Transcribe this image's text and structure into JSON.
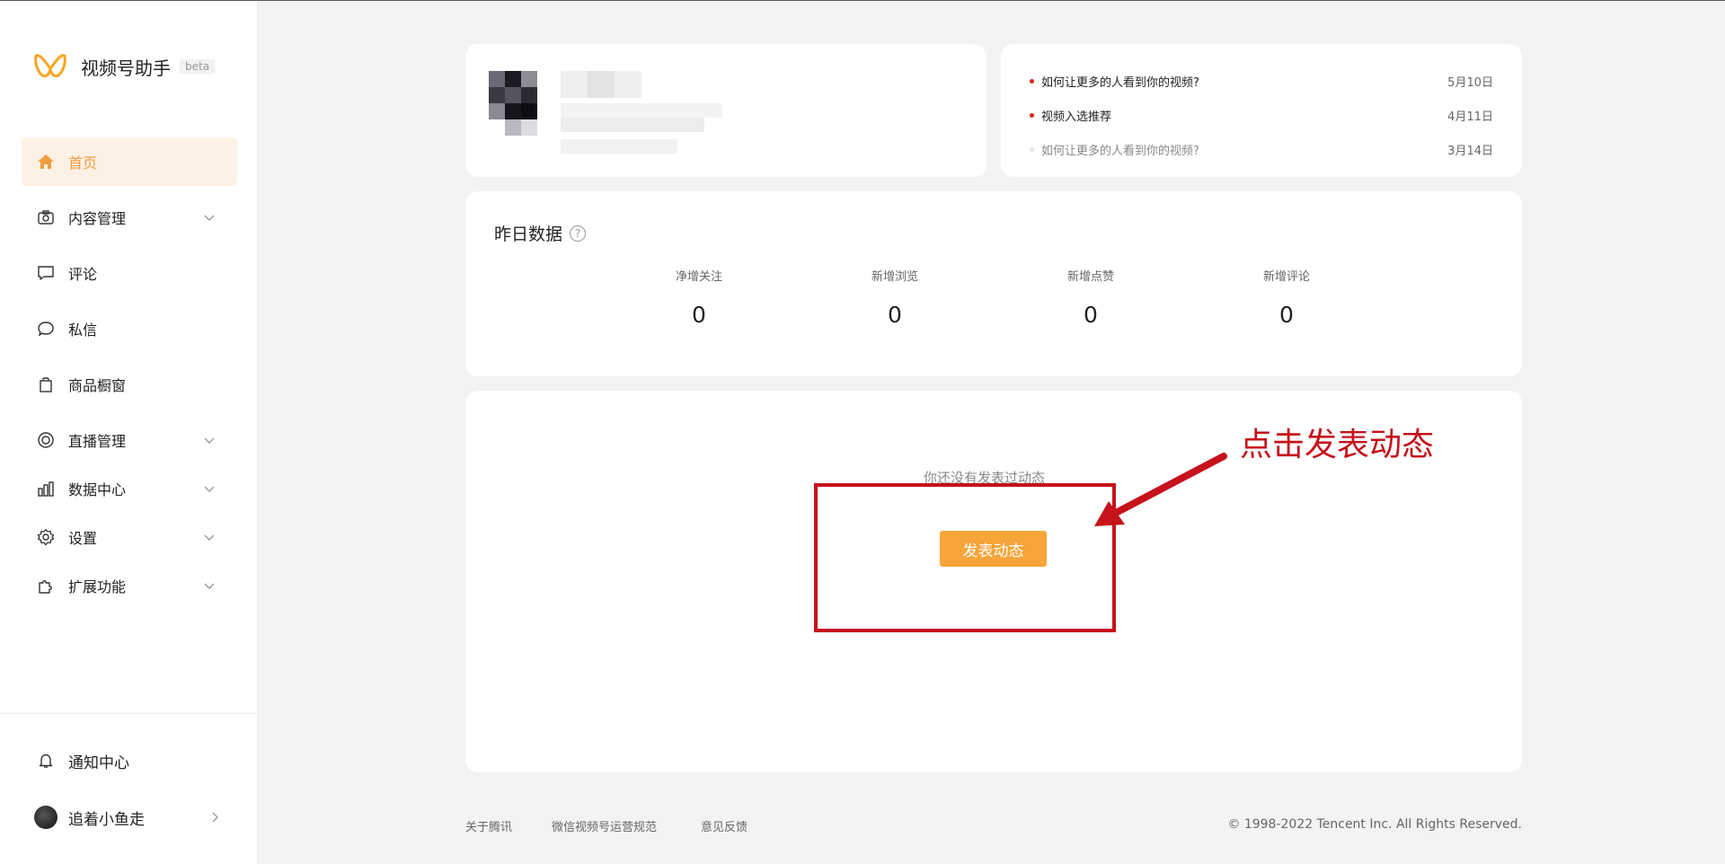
{
  "app": {
    "name": "视频号助手",
    "badge": "beta"
  },
  "sidebar": {
    "items": [
      {
        "label": "首页",
        "icon": "home-icon",
        "active": true
      },
      {
        "label": "内容管理",
        "icon": "camera-icon",
        "expandable": true
      },
      {
        "label": "评论",
        "icon": "comment-icon"
      },
      {
        "label": "私信",
        "icon": "message-icon"
      },
      {
        "label": "商品橱窗",
        "icon": "shopping-bag-icon"
      },
      {
        "label": "直播管理",
        "icon": "live-icon",
        "expandable": true
      },
      {
        "label": "数据中心",
        "icon": "bar-chart-icon",
        "expandable": true
      },
      {
        "label": "设置",
        "icon": "gear-icon",
        "expandable": true
      },
      {
        "label": "扩展功能",
        "icon": "puzzle-icon",
        "expandable": true
      }
    ],
    "bottom": {
      "notifications": "通知中心",
      "username": "追着小鱼走"
    }
  },
  "news": [
    {
      "title": "如何让更多的人看到你的视频?",
      "date": "5月10日",
      "unread": true
    },
    {
      "title": "视频入选推荐",
      "date": "4月11日",
      "unread": true
    },
    {
      "title": "如何让更多的人看到你的视频?",
      "date": "3月14日",
      "unread": false
    }
  ],
  "yesterday": {
    "title": "昨日数据",
    "help": "?",
    "metrics": [
      {
        "label": "净增关注",
        "value": "0"
      },
      {
        "label": "新增浏览",
        "value": "0"
      },
      {
        "label": "新增点赞",
        "value": "0"
      },
      {
        "label": "新增评论",
        "value": "0"
      }
    ]
  },
  "posts": {
    "empty_text": "你还没有发表过动态",
    "publish_button": "发表动态"
  },
  "annotation": {
    "text": "点击发表动态",
    "color": "#c5121b"
  },
  "footer": {
    "links": [
      "关于腾讯",
      "微信视频号运营规范",
      "意见反馈"
    ],
    "copyright": "© 1998-2022 Tencent Inc. All Rights Reserved."
  },
  "colors": {
    "accent": "#f7a43a",
    "active_bg": "#fdf0e4",
    "unread_dot": "#e0201d"
  }
}
